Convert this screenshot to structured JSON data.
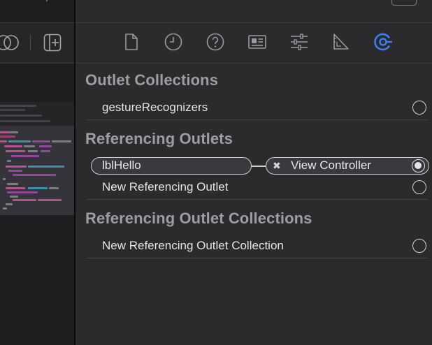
{
  "inspector": {
    "tabs": [
      {
        "name": "file-inspector-icon"
      },
      {
        "name": "history-inspector-icon"
      },
      {
        "name": "quick-help-icon"
      },
      {
        "name": "identity-inspector-icon"
      },
      {
        "name": "attributes-inspector-icon"
      },
      {
        "name": "size-inspector-icon"
      },
      {
        "name": "connections-inspector-icon",
        "selected": true
      }
    ],
    "accent_color": "#3d7ef2",
    "sections": {
      "outlet_collections": {
        "title": "Outlet Collections",
        "rows": [
          "gestureRecognizers"
        ]
      },
      "referencing_outlets": {
        "title": "Referencing Outlets",
        "connection": {
          "outlet": "lblHello",
          "remove_symbol": "✖",
          "target": "View Controller"
        },
        "new_label": "New Referencing Outlet"
      },
      "referencing_outlet_collections": {
        "title": "Referencing Outlet Collections",
        "new_label": "New Referencing Outlet Collection"
      }
    }
  }
}
